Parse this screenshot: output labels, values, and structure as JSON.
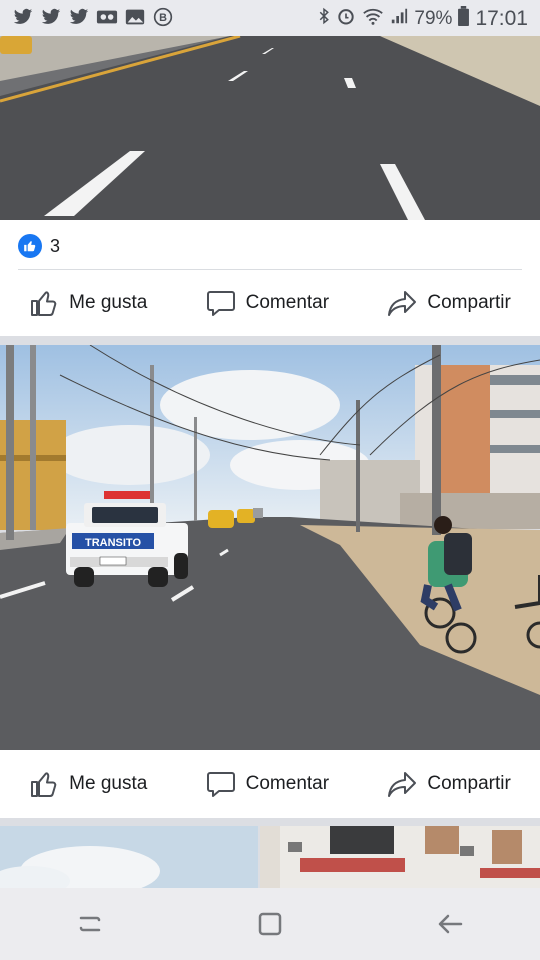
{
  "status_bar": {
    "battery": "79%",
    "time": "17:01",
    "left_icons": [
      "twitter-icon",
      "twitter-icon",
      "twitter-icon",
      "voicemail-icon",
      "image-icon",
      "b-circle-icon"
    ],
    "right_icons": [
      "bluetooth-icon",
      "alarm-icon",
      "wifi-icon",
      "signal-icon",
      "battery-icon"
    ]
  },
  "post1": {
    "reaction_count": "3",
    "actions": {
      "like": "Me gusta",
      "comment": "Comentar",
      "share": "Compartir"
    }
  },
  "post2": {
    "actions": {
      "like": "Me gusta",
      "comment": "Comentar",
      "share": "Compartir"
    },
    "photo": {
      "vehicle_text": "TRANSITO"
    }
  },
  "navbar": {
    "icons": [
      "recent-apps-icon",
      "home-icon",
      "back-icon"
    ]
  },
  "colors": {
    "accent": "#1877f2",
    "background": "#dcdee3"
  }
}
